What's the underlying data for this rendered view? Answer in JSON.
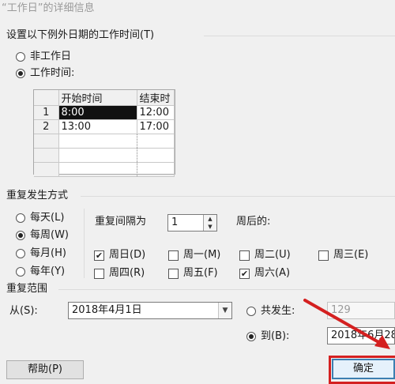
{
  "dialog": {
    "title": "“工作日”的详细信息",
    "section_heading": "设置以下例外日期的工作时间(T)",
    "mode_options": [
      {
        "label": "非工作日",
        "checked": false
      },
      {
        "label": "工作时间:",
        "checked": true
      }
    ],
    "time_table": {
      "headers": [
        "",
        "开始时间",
        "结束时"
      ],
      "rows": [
        {
          "n": "1",
          "start": "8:00",
          "end": "12:00"
        },
        {
          "n": "2",
          "start": "13:00",
          "end": "17:00"
        }
      ]
    },
    "recurrence": {
      "heading": "重复发生方式",
      "options": [
        {
          "label": "每天(L)",
          "checked": false
        },
        {
          "label": "每周(W)",
          "checked": true
        },
        {
          "label": "每月(H)",
          "checked": false
        },
        {
          "label": "每年(Y)",
          "checked": false
        }
      ],
      "interval_label": "重复间隔为",
      "interval_value": "1",
      "after_label": "周后的:",
      "weekdays": [
        {
          "label": "周日(D)",
          "checked": true
        },
        {
          "label": "周一(M)",
          "checked": false
        },
        {
          "label": "周二(U)",
          "checked": false
        },
        {
          "label": "周三(E)",
          "checked": false
        },
        {
          "label": "周四(R)",
          "checked": false
        },
        {
          "label": "周五(F)",
          "checked": false
        },
        {
          "label": "周六(A)",
          "checked": true
        }
      ]
    },
    "range": {
      "heading": "重复范围",
      "from_label": "从(S):",
      "from_value": "2018年4月1日",
      "occurrences_label": "共发生:",
      "occurrences_value": "129",
      "occurrences_checked": false,
      "to_label": "到(B):",
      "to_value": "2018年6月28",
      "to_checked": true
    },
    "buttons": {
      "help": "帮助(P)",
      "ok": "确定"
    },
    "colors": {
      "annotation_red": "#d42020",
      "focus_blue": "#3c7fb1"
    }
  }
}
